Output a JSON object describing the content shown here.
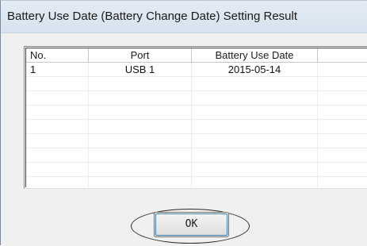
{
  "window": {
    "title": "Battery Use Date (Battery Change Date) Setting Result"
  },
  "table": {
    "columns": [
      "No.",
      "Port",
      "Battery Use Date"
    ],
    "rows": [
      {
        "no": "1",
        "port": "USB 1",
        "date": "2015-05-14"
      }
    ]
  },
  "buttons": {
    "ok_label": "OK"
  }
}
